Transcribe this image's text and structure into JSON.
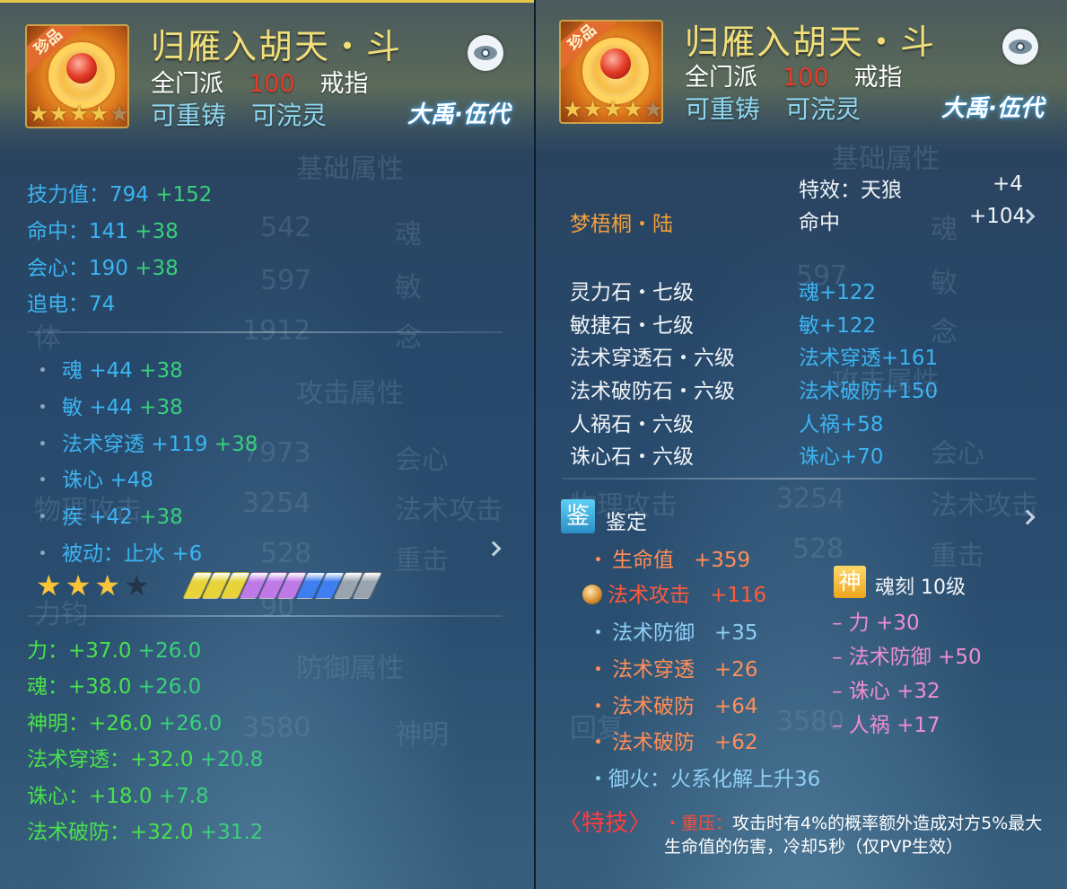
{
  "colors": {
    "title": "#f2df7a",
    "level": "#e83a2a",
    "stat_blue": "#3cb4f2",
    "stat_green": "#39d07b",
    "bonus_green": "#49e24a",
    "gem_name": "#f4a03a",
    "skill_red": "#ff3d3d"
  },
  "left": {
    "item": {
      "badge": "珍品",
      "title": "归雁入胡天・斗",
      "school": "全门派",
      "level": "100",
      "slot": "戒指",
      "tag1": "可重铸",
      "tag2": "可浣灵",
      "logo": "大禹·伍代",
      "icon_stars": 4,
      "eye_icon": "eye-icon"
    },
    "ghost_text": [
      {
        "text": "基础属性"
      },
      {
        "text": "542"
      },
      {
        "text": "魂"
      },
      {
        "text": "597"
      },
      {
        "text": "敏"
      },
      {
        "text": "体"
      },
      {
        "text": "1912"
      },
      {
        "text": "念"
      },
      {
        "text": "攻击属性"
      },
      {
        "text": "7973"
      },
      {
        "text": "会心"
      },
      {
        "text": "物理攻击"
      },
      {
        "text": "3254"
      },
      {
        "text": "法术攻击"
      },
      {
        "text": "528"
      },
      {
        "text": "重击"
      },
      {
        "text": "力钧"
      },
      {
        "text": "90"
      },
      {
        "text": "防御属性"
      },
      {
        "text": "3580"
      },
      {
        "text": "神明"
      }
    ],
    "base_stats": [
      {
        "label": "技力值：",
        "value": "794",
        "bonus": "+152"
      },
      {
        "label": "命中：",
        "value": "141",
        "bonus": "+38"
      },
      {
        "label": "会心：",
        "value": "190",
        "bonus": "+38"
      },
      {
        "label": "追电：",
        "value": "74",
        "bonus": ""
      }
    ],
    "sub_stats": [
      {
        "label": "魂",
        "value": "+44",
        "bonus": "+38"
      },
      {
        "label": "敏",
        "value": "+44",
        "bonus": "+38"
      },
      {
        "label": "法术穿透",
        "value": "+119",
        "bonus": "+38"
      },
      {
        "label": "诛心",
        "value": "+48",
        "bonus": ""
      },
      {
        "label": "疾",
        "value": "+42",
        "bonus": "+38"
      },
      {
        "label": "被动：止水",
        "value": "+6",
        "bonus": ""
      }
    ],
    "star_rating": 3,
    "star_max": 4,
    "refine_bars": [
      {
        "color": "#e8d43a"
      },
      {
        "color": "#e8d43a"
      },
      {
        "color": "#e8d43a"
      },
      {
        "color": "#c07ae8"
      },
      {
        "color": "#c07ae8"
      },
      {
        "color": "#c07ae8"
      },
      {
        "color": "#3f7ef0"
      },
      {
        "color": "#3f7ef0"
      },
      {
        "color": "#9aa4ae"
      },
      {
        "color": "#9aa4ae"
      }
    ],
    "bonus_stats": [
      {
        "label": "力：",
        "value": "+37.0",
        "bonus": "+26.0"
      },
      {
        "label": "魂：",
        "value": "+38.0",
        "bonus": "+26.0"
      },
      {
        "label": "神明：",
        "value": "+26.0",
        "bonus": "+26.0"
      },
      {
        "label": "法术穿透：",
        "value": "+32.0",
        "bonus": "+20.8"
      },
      {
        "label": "诛心：",
        "value": "+18.0",
        "bonus": "+7.8"
      },
      {
        "label": "法术破防：",
        "value": "+32.0",
        "bonus": "+31.2"
      }
    ]
  },
  "right": {
    "item": {
      "badge": "珍品",
      "title": "归雁入胡天・斗",
      "school": "全门派",
      "level": "100",
      "slot": "戒指",
      "tag1": "可重铸",
      "tag2": "可浣灵",
      "logo": "大禹·伍代",
      "icon_stars": 4
    },
    "ghost_text": [
      {
        "text": "基础属性"
      },
      {
        "text": "魂"
      },
      {
        "text": "597"
      },
      {
        "text": "敏"
      },
      {
        "text": "念"
      },
      {
        "text": "攻击属性"
      },
      {
        "text": "会心"
      },
      {
        "text": "物理攻击"
      },
      {
        "text": "3254"
      },
      {
        "text": "法术攻击"
      },
      {
        "text": "528"
      },
      {
        "text": "重击"
      },
      {
        "text": "回复"
      },
      {
        "text": "3580"
      }
    ],
    "effect_label": "特效：天狼",
    "effect_value": "+4",
    "hit_label": "命中",
    "hit_value": "+104",
    "jade_name": "梦梧桐・陆",
    "gems": [
      {
        "name": "灵力石・七级",
        "effect": "魂+122"
      },
      {
        "name": "敏捷石・七级",
        "effect": "敏+122"
      },
      {
        "name": "法术穿透石・六级",
        "effect": "法术穿透+161"
      },
      {
        "name": "法术破防石・六级",
        "effect": "法术破防+150"
      },
      {
        "name": "人祸石・六级",
        "effect": "人祸+58"
      },
      {
        "name": "诛心石・六级",
        "effect": "诛心+70"
      }
    ],
    "appraise_icon": "鉴",
    "appraise_label": "鉴定",
    "appraise_stats": [
      {
        "label": "生命值",
        "value": "+359",
        "style": "salmon",
        "marker": "・"
      },
      {
        "label": "法术攻击",
        "value": "+116",
        "style": "red",
        "marker": "gem"
      },
      {
        "label": "法术防御",
        "value": "+35",
        "style": "ltblue",
        "marker": "・"
      },
      {
        "label": "法术穿透",
        "value": "+26",
        "style": "salmon",
        "marker": "・"
      },
      {
        "label": "法术破防",
        "value": "+64",
        "style": "salmon",
        "marker": "・"
      },
      {
        "label": "法术破防",
        "value": "+62",
        "style": "salmon",
        "marker": "・"
      }
    ],
    "fire_resist": "・御火：火系化解上升36",
    "soul_icon": "神",
    "soul_title": "魂刻 10级",
    "soul_stats": [
      {
        "label": "– 力",
        "value": "+30"
      },
      {
        "label": "– 法术防御",
        "value": "+50"
      },
      {
        "label": "– 诛心",
        "value": "+32"
      },
      {
        "label": "– 人祸",
        "value": "+17"
      }
    ],
    "skill_title": "〈特技〉",
    "skill_name": "・重压：",
    "skill_desc": "攻击时有4%的概率额外造成对方5%最大生命值的伤害，冷却5秒（仅PVP生效）"
  }
}
